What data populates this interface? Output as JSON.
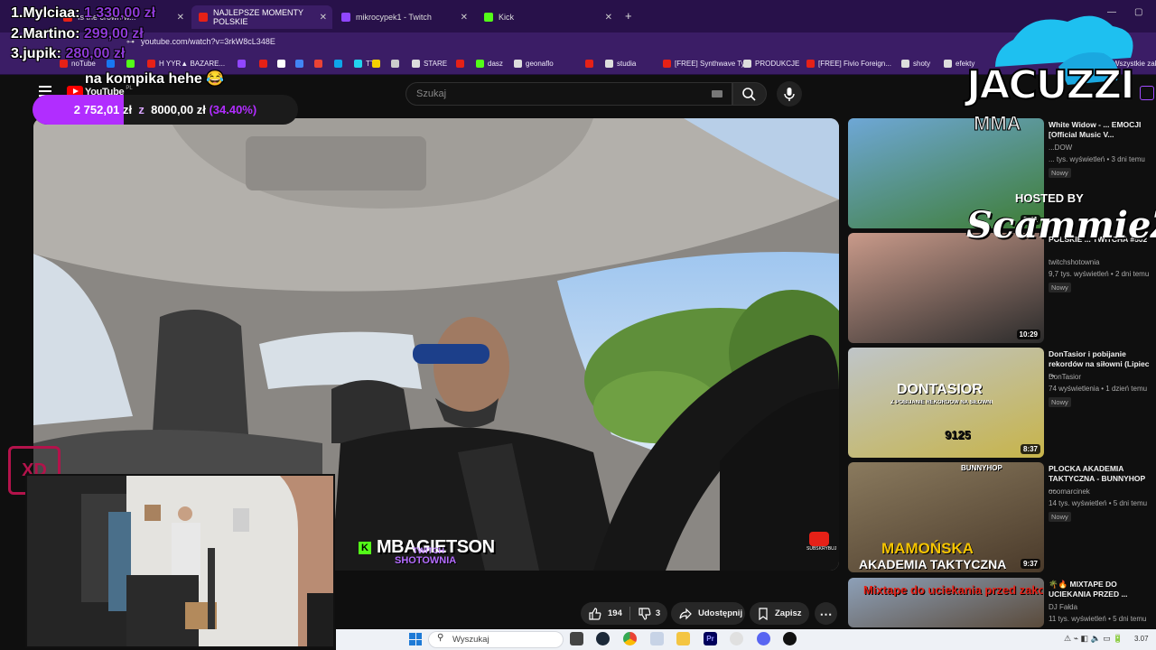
{
  "tabs": [
    {
      "label": "Is the crown w...",
      "color": "#e62117"
    },
    {
      "label": "NAJLEPSZE MOMENTY POLSKIE",
      "color": "#e62117"
    },
    {
      "label": "mikrocypek1 - Twitch",
      "color": "#9146ff"
    },
    {
      "label": "Kick",
      "color": "#53fc18"
    }
  ],
  "address": {
    "url": "youtube.com/watch?v=3rkW8cL348E"
  },
  "bookmarks": [
    {
      "label": "noTube",
      "color": "#e62117"
    },
    {
      "label": "",
      "color": "#1877f2"
    },
    {
      "label": "",
      "color": "#53fc18"
    },
    {
      "label": "H YYR▲ BAZARE...",
      "color": "#e62117"
    },
    {
      "label": "",
      "color": "#9146ff"
    },
    {
      "label": "",
      "color": "#e62117"
    },
    {
      "label": "",
      "color": "#ffffff"
    },
    {
      "label": "",
      "color": "#4285f4"
    },
    {
      "label": "",
      "color": "#ea4335"
    },
    {
      "label": "",
      "color": "#0ea5e9"
    },
    {
      "label": "TT",
      "color": "#22d3ee"
    },
    {
      "label": "",
      "color": "#f5d000"
    },
    {
      "label": "",
      "color": "#cccccc"
    },
    {
      "label": "STARE",
      "color": "#dddddd"
    },
    {
      "label": "",
      "color": "#e62117"
    },
    {
      "label": "dasz",
      "color": "#53fc18"
    },
    {
      "label": "geonaflo",
      "color": "#dddddd"
    },
    {
      "label": "",
      "color": "#e62117"
    },
    {
      "label": "studia",
      "color": "#dddddd"
    },
    {
      "label": "[FREE] Synthwave Ty...",
      "color": "#e62117"
    },
    {
      "label": "PRODUKCJE",
      "color": "#dddddd"
    },
    {
      "label": "[FREE] Fivio Foreign...",
      "color": "#e62117"
    },
    {
      "label": "shoty",
      "color": "#dddddd"
    },
    {
      "label": "efekty",
      "color": "#dddddd"
    }
  ],
  "bookmarks_more": "Wszystkie zak",
  "youtube": {
    "logo": "YouTube",
    "logo_region": "PL",
    "search_placeholder": "Szukaj"
  },
  "video": {
    "overlay_name": "MBAGIETSON",
    "overlay_sub1": "TWITCH",
    "overlay_sub2": "SHOTOWNIA",
    "subscribe": "SUBSKRYBUJ"
  },
  "actions": {
    "likes": "194",
    "dislikes": "3",
    "share": "Udostępnij",
    "save": "Zapisz"
  },
  "sidebar": [
    {
      "title": "White Widow - ... EMOCJI [Official Music V...",
      "channel": "...DOW",
      "meta": "... tys. wyświetleń • 3 dni temu",
      "badge": "Nowy",
      "duration": "3:41",
      "thumb_colors": [
        "#6ea7d6",
        "#3e7d34"
      ]
    },
    {
      "title": "POLSKIE ... TWITCHA #502",
      "channel": "twitchshotownia",
      "meta": "9,7 tys. wyświetleń • 2 dni temu",
      "badge": "Nowy",
      "duration": "10:29",
      "thumb_colors": [
        "#c99a8a",
        "#2b2b2b"
      ]
    },
    {
      "title": "DonTasior i pobijanie rekordów na siłowni (Lipiec ...",
      "channel": "DonTasior",
      "meta": "74 wyświetlenia • 1 dzień temu",
      "badge": "Nowy",
      "duration": "8:37",
      "thumb_colors": [
        "#bfc5c9",
        "#c7b44a"
      ]
    },
    {
      "title": "PLOCKA AKADEMIA TAKTYCZNA - BUNNYHOP ...",
      "channel": "ooomarcinek",
      "meta": "14 tys. wyświetleń • 5 dni temu",
      "badge": "Nowy",
      "duration": "9:37",
      "thumb_colors": [
        "#8a7a5e",
        "#4a3a2a"
      ]
    },
    {
      "title": "🌴🔥 MIXTAPE DO UCIEKANIA PRZED ...",
      "channel": "DJ Fałda",
      "meta": "11 tys. wyświetleń • 5 dni temu",
      "badge": "",
      "duration": "",
      "thumb_colors": [
        "#8da0b8",
        "#5a4a3a"
      ]
    }
  ],
  "thumb_texts": {
    "t3_a": "DONTASIOR",
    "t3_b": "Z POBIJANIE REKORDÓW NA SIŁOWNI",
    "t3_c": "9125",
    "t4_a": "BUNNYHOP",
    "t4_b": "MAMOŃSKA",
    "t4_c": "AKADEMIA TAKTYCZNA",
    "t5_a": "Mixtape do uciekania przed zakorami"
  },
  "leaderboard": [
    {
      "rank": "1.",
      "name": "Mylciaa:",
      "amount": "1 330,00 zł"
    },
    {
      "rank": "2.",
      "name": "Martino:",
      "amount": "299,00 zł"
    },
    {
      "rank": "3.",
      "name": "jupik:",
      "amount": "280,00 zł"
    }
  ],
  "donation_message": "na kompika hehe 😂",
  "goal": {
    "current": "2 752,01 zł",
    "separator": "z",
    "target": "8000,00 zł",
    "percent": "(34.40%)",
    "fraction": 0.344
  },
  "branding": {
    "jacuzzi": "JACUZZI",
    "mma": "MMA",
    "hosted_by": "HOSTED BY",
    "host": "ScammieZ",
    "xd": "XD"
  },
  "taskbar": {
    "search": "Wyszukaj",
    "time": "3.07"
  }
}
